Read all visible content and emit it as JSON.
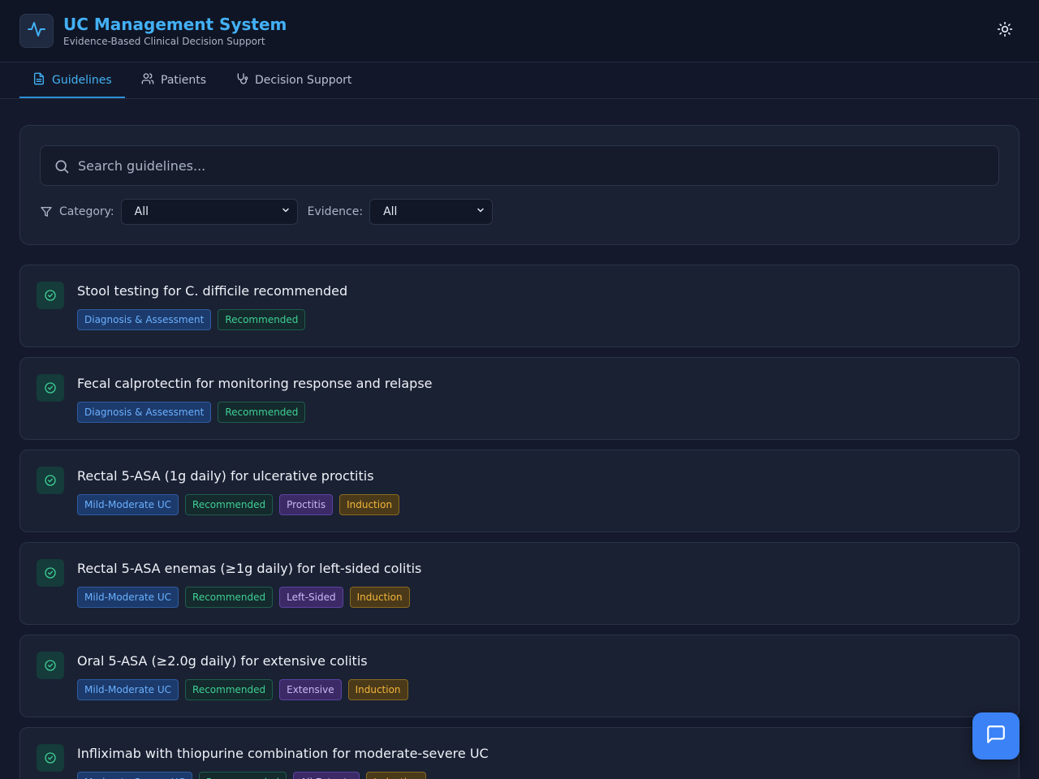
{
  "header": {
    "title": "UC Management System",
    "subtitle": "Evidence-Based Clinical Decision Support",
    "logo_icon": "activity-pulse-icon",
    "theme_icon": "sun-icon"
  },
  "tabs": [
    {
      "label": "Guidelines",
      "icon": "document-icon",
      "active": true
    },
    {
      "label": "Patients",
      "icon": "users-icon",
      "active": false
    },
    {
      "label": "Decision Support",
      "icon": "stethoscope-icon",
      "active": false
    }
  ],
  "search": {
    "placeholder": "Search guidelines...",
    "value": ""
  },
  "filters": {
    "category_label": "Category:",
    "category_value": "All",
    "evidence_label": "Evidence:",
    "evidence_value": "All"
  },
  "guidelines": [
    {
      "title": "Stool testing for C. difficile recommended",
      "badges": [
        "Diagnosis & Assessment",
        "Recommended"
      ]
    },
    {
      "title": "Fecal calprotectin for monitoring response and relapse",
      "badges": [
        "Diagnosis & Assessment",
        "Recommended"
      ]
    },
    {
      "title": "Rectal 5-ASA (1g daily) for ulcerative proctitis",
      "badges": [
        "Mild-Moderate UC",
        "Recommended",
        "Proctitis",
        "Induction"
      ]
    },
    {
      "title": "Rectal 5-ASA enemas (≥1g daily) for left-sided colitis",
      "badges": [
        "Mild-Moderate UC",
        "Recommended",
        "Left-Sided",
        "Induction"
      ]
    },
    {
      "title": "Oral 5-ASA (≥2.0g daily) for extensive colitis",
      "badges": [
        "Mild-Moderate UC",
        "Recommended",
        "Extensive",
        "Induction"
      ]
    },
    {
      "title": "Infliximab with thiopurine combination for moderate-severe UC",
      "badges": [
        "Moderate-Severe UC",
        "Recommended",
        "All Extents",
        "Induction"
      ]
    }
  ],
  "colors": {
    "accent": "#43b0f5",
    "background": "#141a2b",
    "card": "#1a2133",
    "chat_button": "#3b82f6"
  },
  "chat_icon": "message-square-icon"
}
